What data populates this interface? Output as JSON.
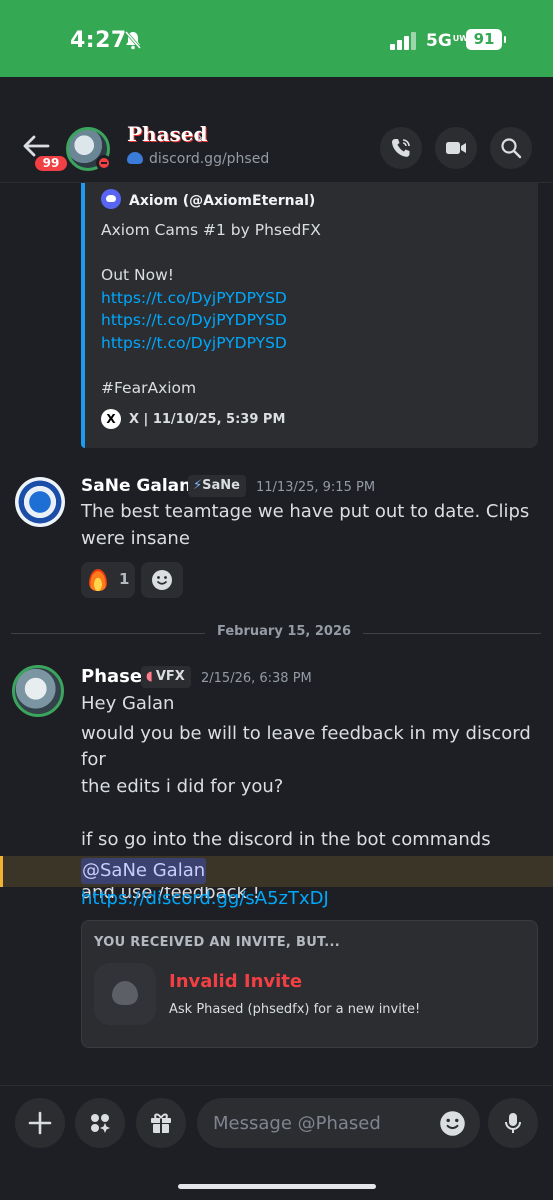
{
  "status_bar": {
    "time": "4:27",
    "network": "5G",
    "network_sup": "UW",
    "battery": "91"
  },
  "header": {
    "unread_count": "99",
    "name": "Phased",
    "subtitle": "discord.gg/phsed"
  },
  "embed": {
    "author": "Axiom (@AxiomEternal)",
    "title_line": "Axiom Cams #1 by PhsedFX",
    "out_now": "Out Now!",
    "links": [
      "https://t.co/DyjPYDPYSD",
      "https://t.co/DyjPYDPYSD",
      "https://t.co/DyjPYDPYSD"
    ],
    "hashtag": "#FearAxiom",
    "footer": "X | 11/10/25, 5:39 PM"
  },
  "message_sane": {
    "author": "SaNe Galan",
    "tag": "SaNe",
    "timestamp": "11/13/25, 9:15 PM",
    "line1": "The best teamtage we have put out to date. Clips",
    "line2": "were insane",
    "reaction_count": "1"
  },
  "date_divider": "February 15, 2026",
  "message_phased": {
    "author": "Phased",
    "tag": "VFX",
    "timestamp": "2/15/26, 6:38 PM",
    "lines": [
      "Hey Galan",
      "would you be will to leave feedback in my discord for",
      "the edits i did for you?",
      "",
      "if so go into the discord in the bot commands section",
      "and use /feedback !"
    ],
    "mention": "@SaNe Galan",
    "link": "https://discord.gg/sA5zTxDJ"
  },
  "invite": {
    "heading": "YOU RECEIVED AN INVITE, BUT...",
    "title": "Invalid Invite",
    "subtitle": "Ask Phased (phsedfx) for a new invite!"
  },
  "composer": {
    "placeholder": "Message @Phased"
  }
}
